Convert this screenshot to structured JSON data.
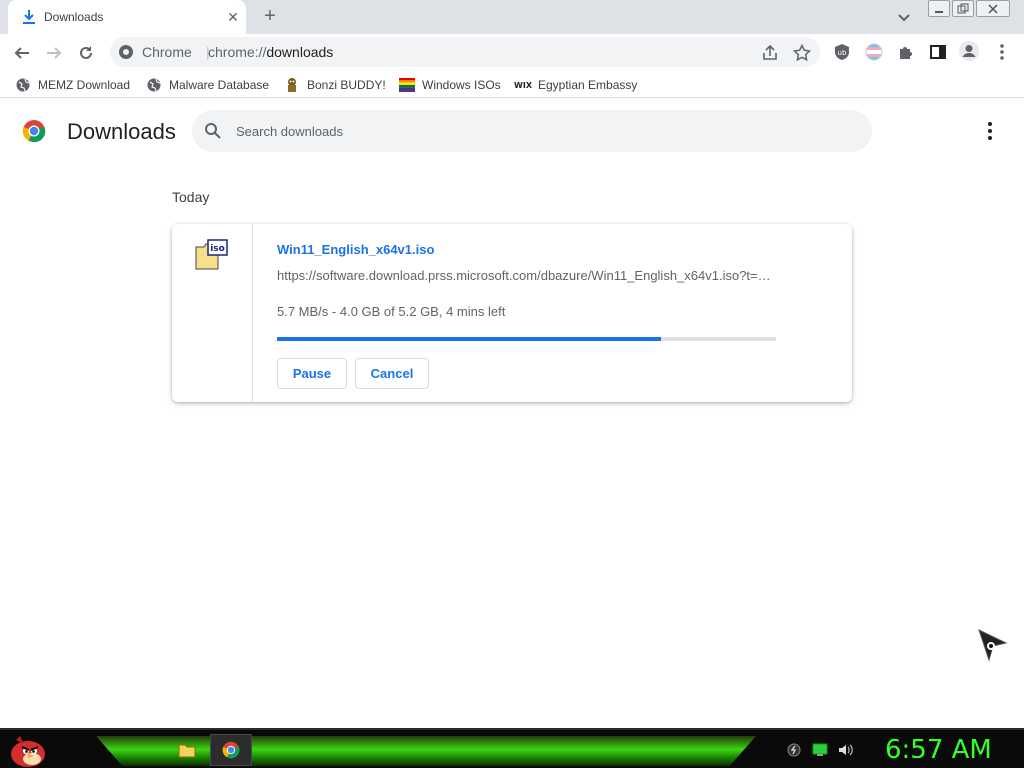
{
  "tab": {
    "title": "Downloads",
    "close_glyph": "✕"
  },
  "new_tab_glyph": "+",
  "omnibox": {
    "chip": "Chrome",
    "separator": "|",
    "url_scheme": "chrome://",
    "url_host": "downloads"
  },
  "bookmarks": [
    {
      "label": "MEMZ Download",
      "icon": "globe-icon"
    },
    {
      "label": "Malware Database",
      "icon": "globe-icon"
    },
    {
      "label": "Bonzi BUDDY!",
      "icon": "bonzi-icon"
    },
    {
      "label": "Windows ISOs",
      "icon": "rainbow-flag-icon"
    },
    {
      "label": "Egyptian Embassy",
      "icon": "wix-icon"
    }
  ],
  "bookmark_wix_text": "WIX",
  "page": {
    "title": "Downloads",
    "search_placeholder": "Search downloads",
    "date_heading": "Today"
  },
  "download": {
    "file_name": "Win11_English_x64v1.iso",
    "url": "https://software.download.prss.microsoft.com/dbazure/Win11_English_x64v1.iso?t=…",
    "status": "5.7 MB/s - 4.0 GB of 5.2 GB, 4 mins left",
    "progress": 0.77,
    "icon_label": "iso",
    "pause_label": "Pause",
    "cancel_label": "Cancel"
  },
  "taskbar": {
    "clock": "6:57 AM"
  },
  "colors": {
    "accent": "#1a73e8",
    "clock": "#35ff2a",
    "taskbar_glow": "#3ed411"
  }
}
